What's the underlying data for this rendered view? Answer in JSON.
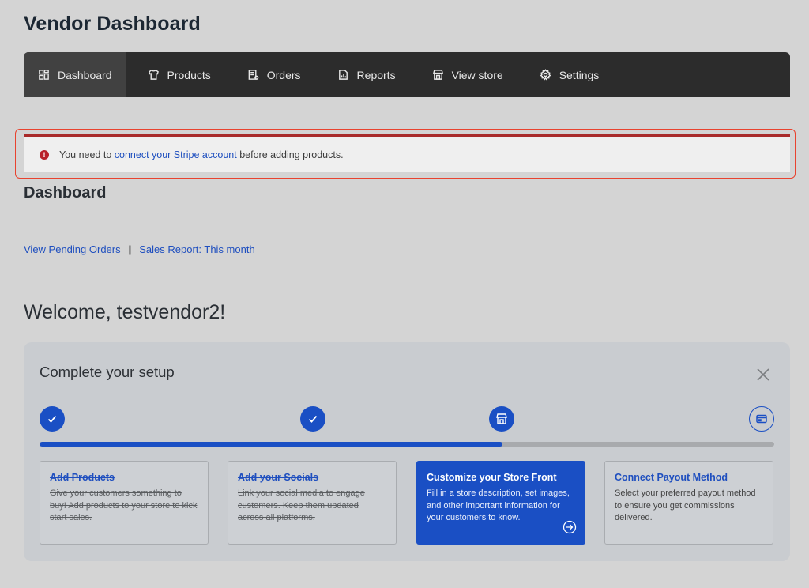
{
  "page_title": "Vendor Dashboard",
  "nav": [
    {
      "label": "Dashboard",
      "icon": "grid-icon",
      "active": true
    },
    {
      "label": "Products",
      "icon": "shirt-icon",
      "active": false
    },
    {
      "label": "Orders",
      "icon": "receipt-icon",
      "active": false
    },
    {
      "label": "Reports",
      "icon": "report-icon",
      "active": false
    },
    {
      "label": "View store",
      "icon": "store-icon",
      "active": false
    },
    {
      "label": "Settings",
      "icon": "gear-icon",
      "active": false
    }
  ],
  "notice": {
    "prefix": "You need to",
    "link": "connect your Stripe account",
    "suffix": "before adding products."
  },
  "section_title": "Dashboard",
  "quick_links": {
    "pending": "View Pending Orders",
    "separator": "|",
    "sales": "Sales Report: This month"
  },
  "welcome": "Welcome, testvendor2!",
  "setup": {
    "title": "Complete your setup",
    "progress": 0.63,
    "steps": [
      {
        "title": "Add Products",
        "desc": "Give your customers something to buy! Add products to your store to kick start sales.",
        "state": "done",
        "icon": "check-icon"
      },
      {
        "title": "Add your Socials",
        "desc": "Link your social media to engage customers. Keep them updated across all platforms.",
        "state": "done",
        "icon": "check-icon"
      },
      {
        "title": "Customize your Store Front",
        "desc": "Fill in a store description, set images, and other important information for your customers to know.",
        "state": "active",
        "icon": "store-icon"
      },
      {
        "title": "Connect Payout Method",
        "desc": "Select your preferred payout method to ensure you get commissions delivered.",
        "state": "pending",
        "icon": "card-icon"
      }
    ]
  },
  "colors": {
    "accent": "#1a4fc4",
    "nav_bg": "#2c2c2c",
    "alert_red": "#b8222a",
    "outline_red": "#e8432f"
  }
}
